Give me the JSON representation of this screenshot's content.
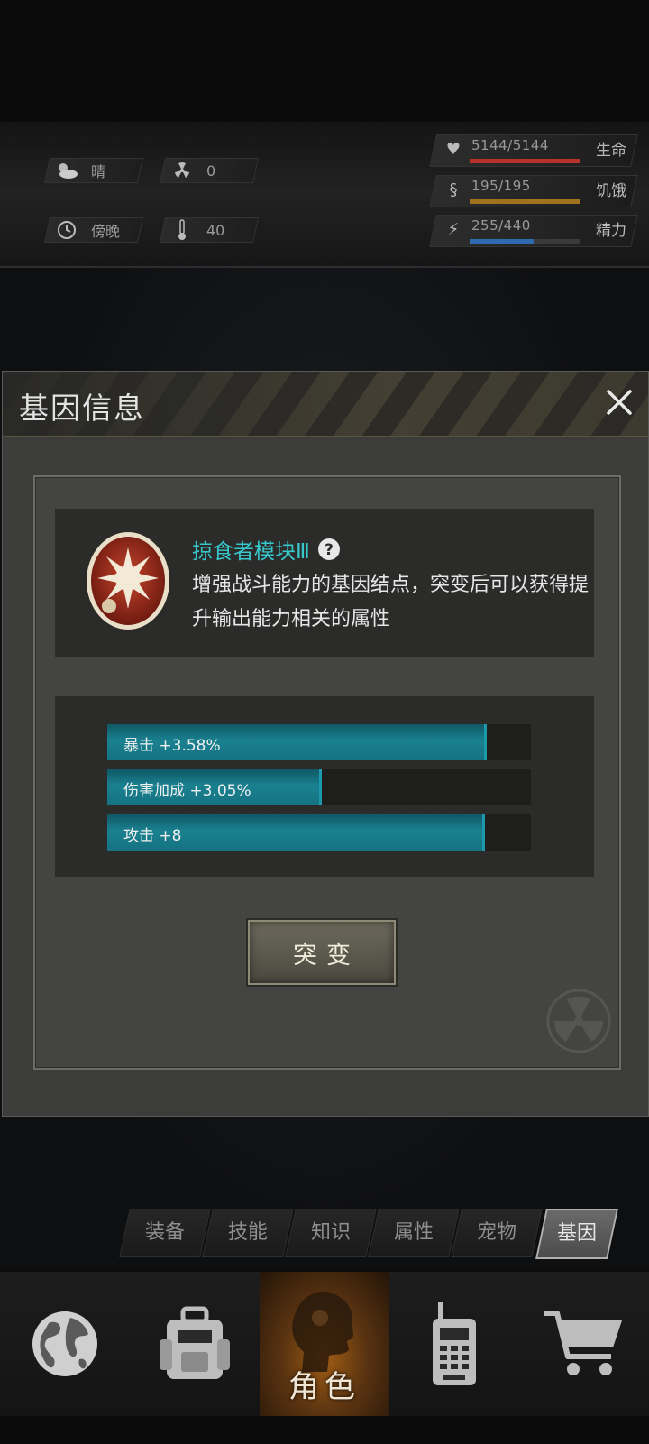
{
  "status": {
    "weather": {
      "icon": "cloud-sun-icon",
      "label": "晴"
    },
    "radiation": {
      "icon": "radiation-icon",
      "value": "0"
    },
    "time": {
      "icon": "clock-icon",
      "label": "傍晚"
    },
    "temperature": {
      "icon": "thermometer-icon",
      "value": "40"
    },
    "vitals": [
      {
        "icon": "heart-icon",
        "value": "5144/5144",
        "name": "生命",
        "fraction": 1.0,
        "color": "#b8322a"
      },
      {
        "icon": "stomach-icon",
        "value": "195/195",
        "name": "饥饿",
        "fraction": 1.0,
        "color": "#a0721f"
      },
      {
        "icon": "energy-head-icon",
        "value": "255/440",
        "name": "精力",
        "fraction": 0.58,
        "color": "#2d6ab0"
      }
    ]
  },
  "dialog": {
    "title": "基因信息",
    "gene": {
      "name": "掠食者模块Ⅲ",
      "description": "增强战斗能力的基因结点，突变后可以获得提升输出能力相关的属性"
    },
    "stats": [
      {
        "label": "暴击 +3.58%",
        "fraction": 0.89
      },
      {
        "label": "伤害加成 +3.05%",
        "fraction": 0.5
      },
      {
        "label": "攻击 +8",
        "fraction": 0.885
      }
    ],
    "mutate_label": "突变"
  },
  "tabs": [
    {
      "label": "装备",
      "active": false
    },
    {
      "label": "技能",
      "active": false
    },
    {
      "label": "知识",
      "active": false
    },
    {
      "label": "属性",
      "active": false
    },
    {
      "label": "宠物",
      "active": false
    },
    {
      "label": "基因",
      "active": true
    }
  ],
  "bottom_nav": {
    "items": [
      "globe-icon",
      "backpack-icon",
      "character-head-icon",
      "walkie-talkie-icon",
      "shopping-cart-icon"
    ],
    "active_label": "角色"
  },
  "colors": {
    "accent_cyan": "#37c8cc",
    "stat_bar": "#1a8190"
  }
}
